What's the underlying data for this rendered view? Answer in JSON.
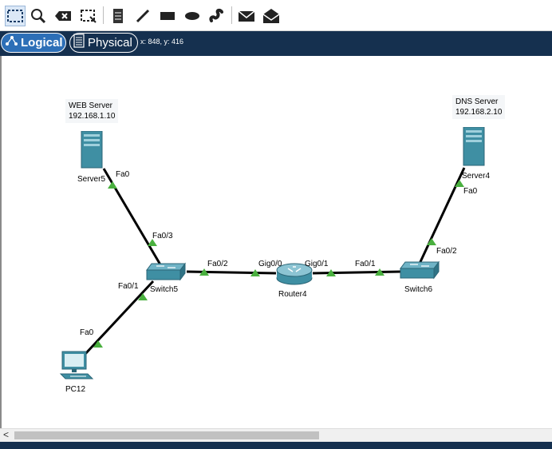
{
  "toolbar": {
    "tools": [
      "select-icon",
      "zoom-icon",
      "delete-icon",
      "resize-icon",
      "note-icon",
      "line-icon",
      "rectangle-icon",
      "ellipse-icon",
      "freeform-icon",
      "simple-pdu-icon",
      "complex-pdu-icon"
    ]
  },
  "viewbar": {
    "logical_label": "Logical",
    "physical_label": "Physical",
    "coords": "x: 848, y: 416"
  },
  "notes": {
    "web": {
      "line1": "WEB Server",
      "line2": "192.168.1.10"
    },
    "dns": {
      "line1": "DNS Server",
      "line2": "192.168.2.10"
    }
  },
  "devices": {
    "server5": "Server5",
    "server4": "Server4",
    "switch5": "Switch5",
    "switch6": "Switch6",
    "router4": "Router4",
    "pc12": "PC12"
  },
  "ports": {
    "server5_fa0": "Fa0",
    "switch5_fa03": "Fa0/3",
    "switch5_fa02": "Fa0/2",
    "switch5_fa01": "Fa0/1",
    "pc12_fa0": "Fa0",
    "router4_gig00": "Gig0/0",
    "router4_gig01": "Gig0/1",
    "switch6_fa01": "Fa0/1",
    "switch6_fa02": "Fa0/2",
    "server4_fa0": "Fa0"
  },
  "colors": {
    "viewbar_bg": "#15304f",
    "logical_tab_bg": "#2d6fb7",
    "link_up": "#4ab03f",
    "device_teal": "#3f8fa3"
  }
}
